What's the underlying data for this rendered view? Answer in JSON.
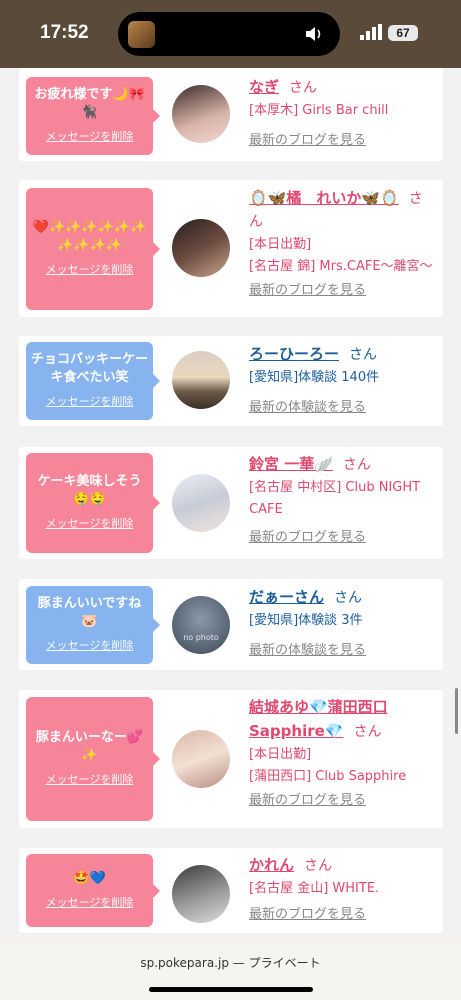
{
  "status": {
    "time": "17:52",
    "battery": "67"
  },
  "browser": {
    "domain": "sp.pokepara.jp",
    "separator": "—",
    "mode": "プライベート"
  },
  "delete_label": "メッセージを削除",
  "items": [
    {
      "message": "お疲れ様です🌙🎀🐈‍⬛",
      "name": "なぎ",
      "san": "さん",
      "line1": "[本厚木] Girls Bar chill",
      "line2": "",
      "more": "最新のブログを見る",
      "color": "pink"
    },
    {
      "message": "❤️✨✨✨✨✨✨✨✨✨✨",
      "name": "🪞🦋橘　れいか🦋🪞",
      "san": "さん",
      "line1": "[本日出勤]",
      "line2": "[名古屋 錦] Mrs.CAFE～離宮～",
      "more": "最新のブログを見る",
      "color": "pink"
    },
    {
      "message": "チョコバッキーケーキ食べたい笑",
      "name": "ろーひーろー",
      "san": "さん",
      "line1": "[愛知県]体験談 140件",
      "line2": "",
      "more": "最新の体験談を見る",
      "color": "blue"
    },
    {
      "message": "ケーキ美味しそう🤤🤤",
      "name": "鈴宮 一華🪽",
      "san": "さん",
      "line1": "[名古屋 中村区] Club NIGHT CAFE",
      "line2": "",
      "more": "最新のブログを見る",
      "color": "pink"
    },
    {
      "message": "豚まんいいですね🐷",
      "name": "だぁーさん",
      "san": "さん",
      "line1": "[愛知県]体験談 3件",
      "line2": "",
      "more": "最新の体験談を見る",
      "color": "blue"
    },
    {
      "message": "豚まんいーなー💕✨",
      "name": "結城あゆ💎蒲田西口Sapphire💎",
      "san": "さん",
      "line1": "[本日出勤]",
      "line2": "[蒲田西口] Club Sapphire",
      "more": "最新のブログを見る",
      "color": "pink"
    },
    {
      "message": "🤩💙",
      "name": "かれん",
      "san": "さん",
      "line1": "[名古屋 金山] WHITE.",
      "line2": "",
      "more": "最新のブログを見る",
      "color": "pink"
    }
  ],
  "avatar_placeholder": "no photo"
}
